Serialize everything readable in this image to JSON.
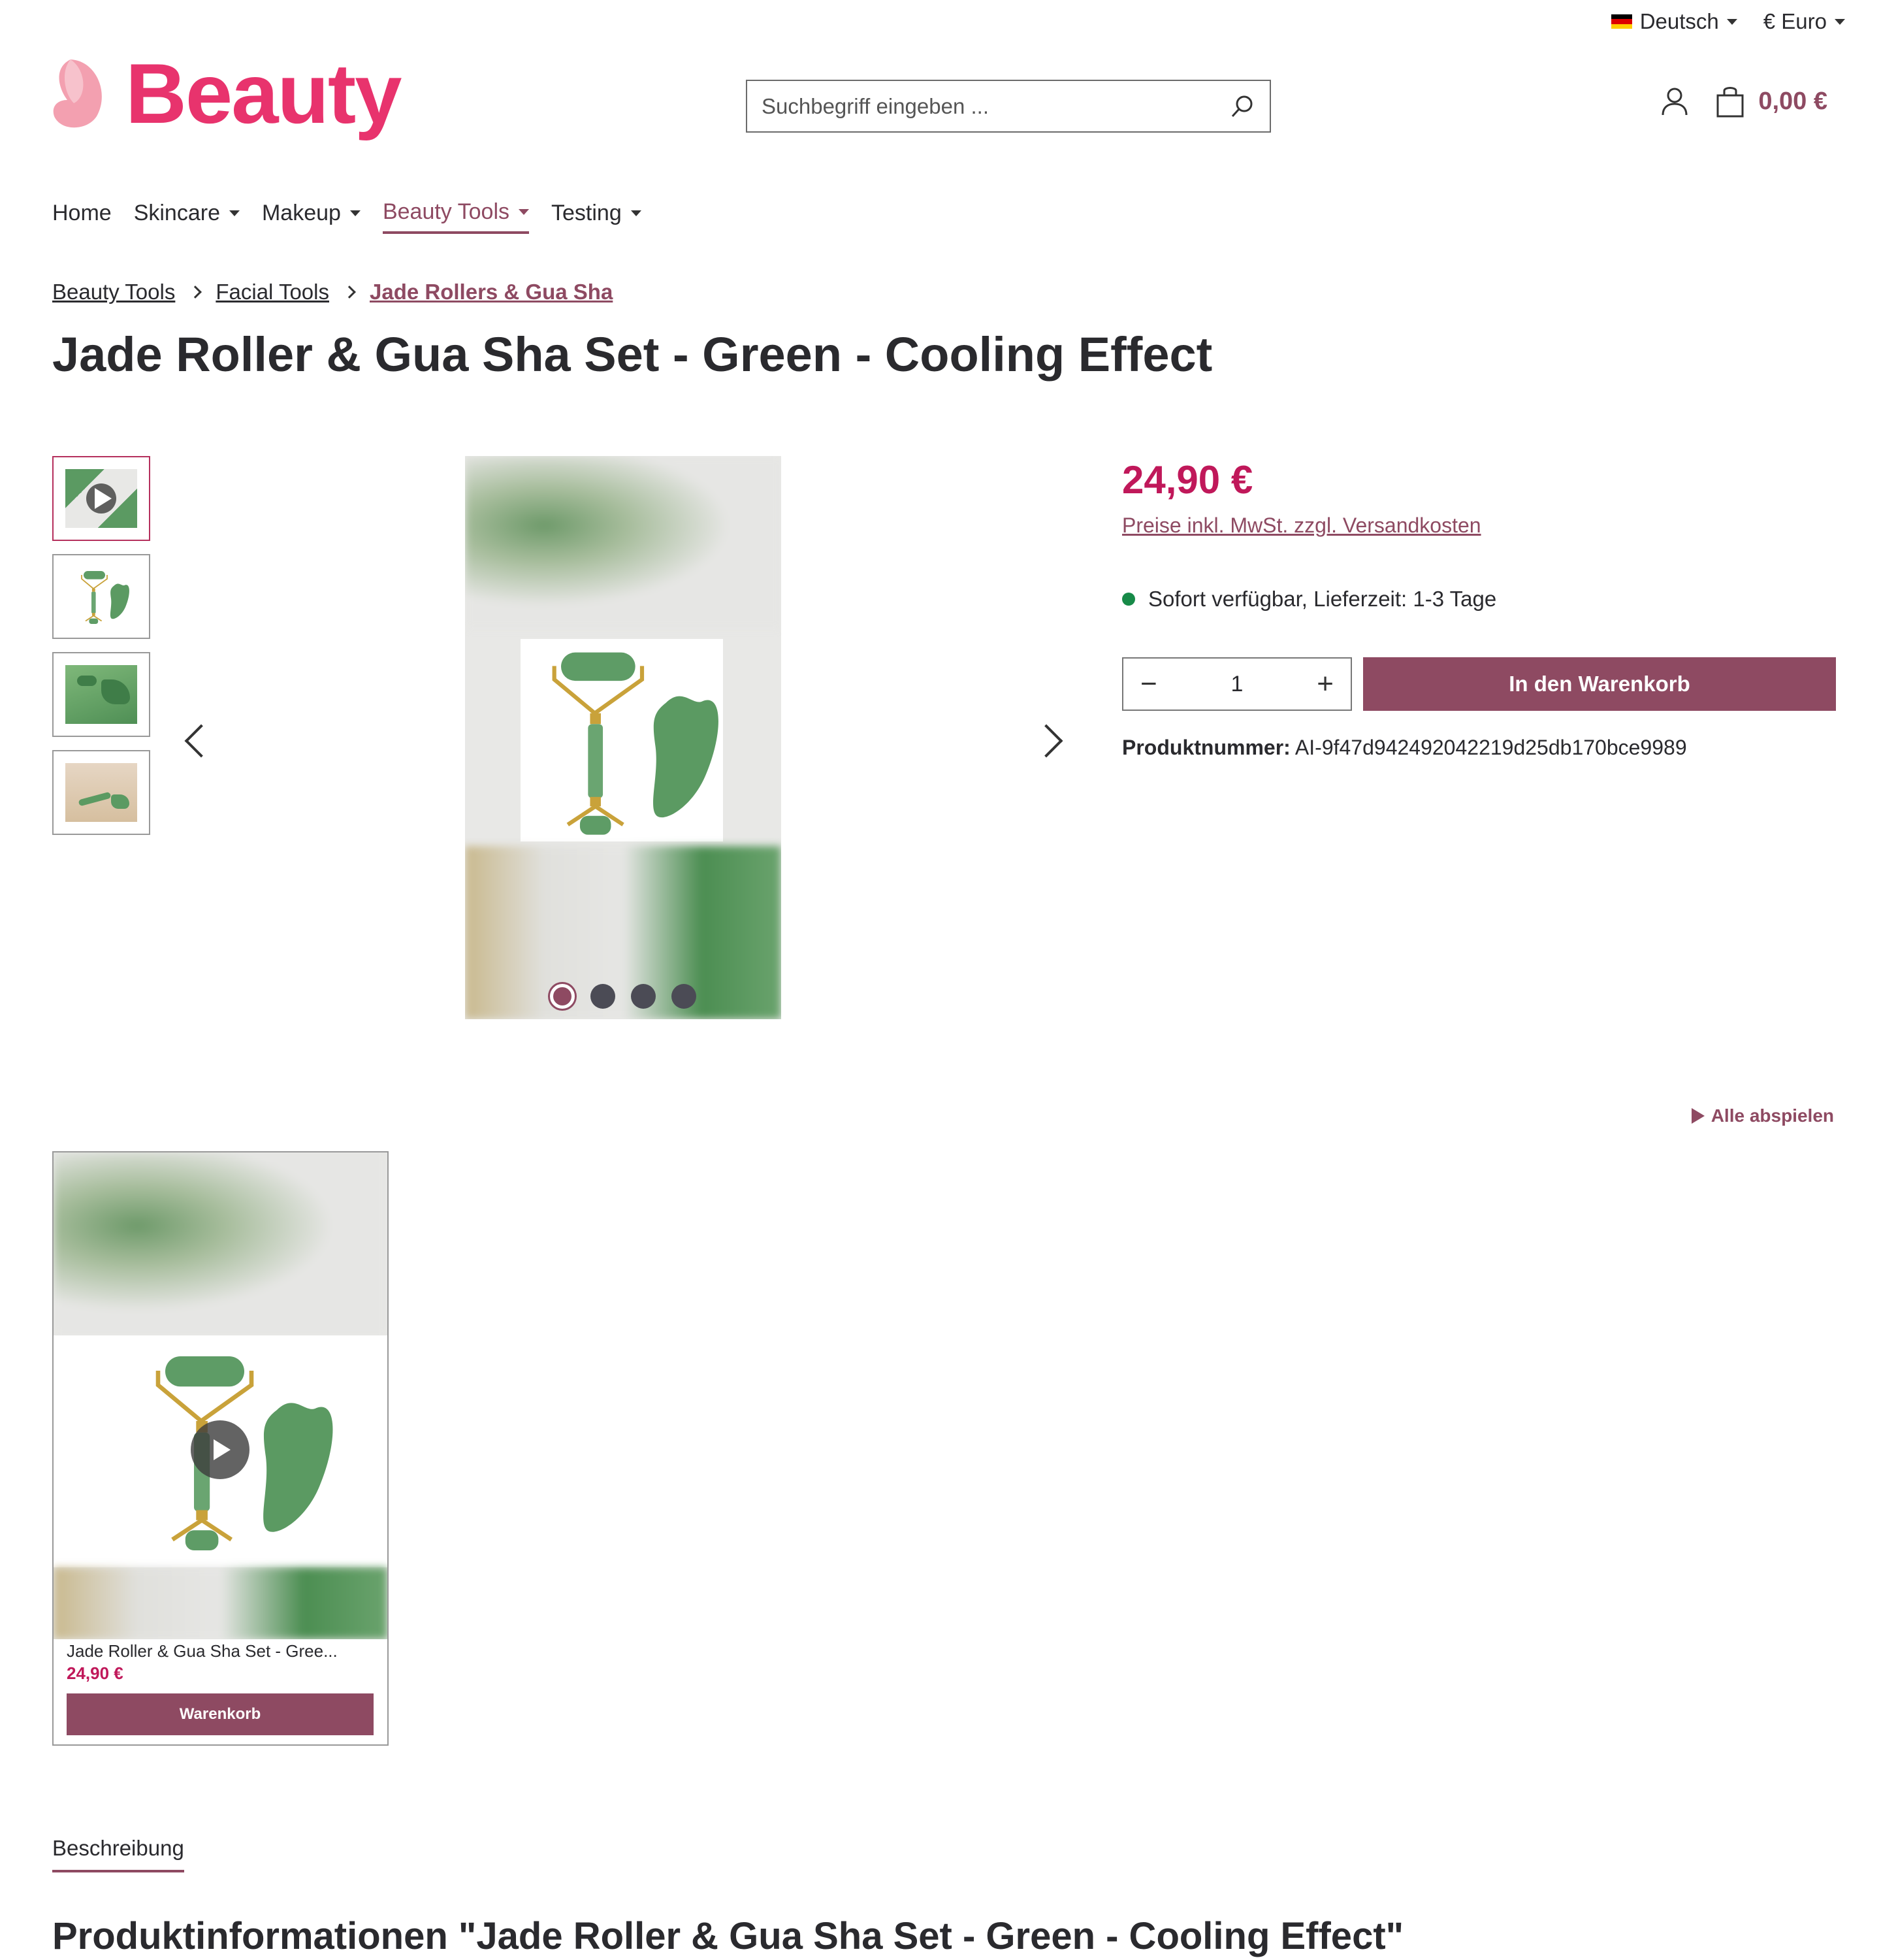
{
  "topbar": {
    "language": "Deutsch",
    "currency": "€ Euro"
  },
  "header": {
    "logo_text": "Beauty",
    "search_placeholder": "Suchbegriff eingeben ...",
    "cart_total": "0,00 €"
  },
  "nav": [
    {
      "label": "Home",
      "has_dropdown": false
    },
    {
      "label": "Skincare",
      "has_dropdown": true
    },
    {
      "label": "Makeup",
      "has_dropdown": true
    },
    {
      "label": "Beauty Tools",
      "has_dropdown": true,
      "active": true
    },
    {
      "label": "Testing",
      "has_dropdown": true
    }
  ],
  "breadcrumb": [
    "Beauty Tools",
    "Facial Tools",
    "Jade Rollers & Gua Sha"
  ],
  "product": {
    "title": "Jade Roller & Gua Sha Set - Green - Cooling Effect",
    "price": "24,90 €",
    "tax_note": "Preise inkl. MwSt. zzgl. Versandkosten",
    "availability": "Sofort verfügbar, Lieferzeit: 1-3 Tage",
    "quantity": "1",
    "add_to_cart": "In den Warenkorb",
    "product_number_label": "Produktnummer:",
    "product_number": "AI-9f47d942492042219d25db170bce9989"
  },
  "gallery": {
    "slide_count": 4,
    "active_slide": 1
  },
  "video_section": {
    "play_all": "Alle abspielen",
    "card_name": "Jade Roller & Gua Sha Set - Gree...",
    "card_price": "24,90 €",
    "card_button": "Warenkorb"
  },
  "tabs": {
    "description": "Beschreibung"
  },
  "description": {
    "heading": "Produktinformationen \"Jade Roller & Gua Sha Set - Green - Cooling Effect\""
  },
  "colors": {
    "accent": "#8e4a62",
    "price": "#c0185a",
    "logo": "#e8336d",
    "jade": "#5b9a62",
    "gold": "#c9a23a"
  }
}
